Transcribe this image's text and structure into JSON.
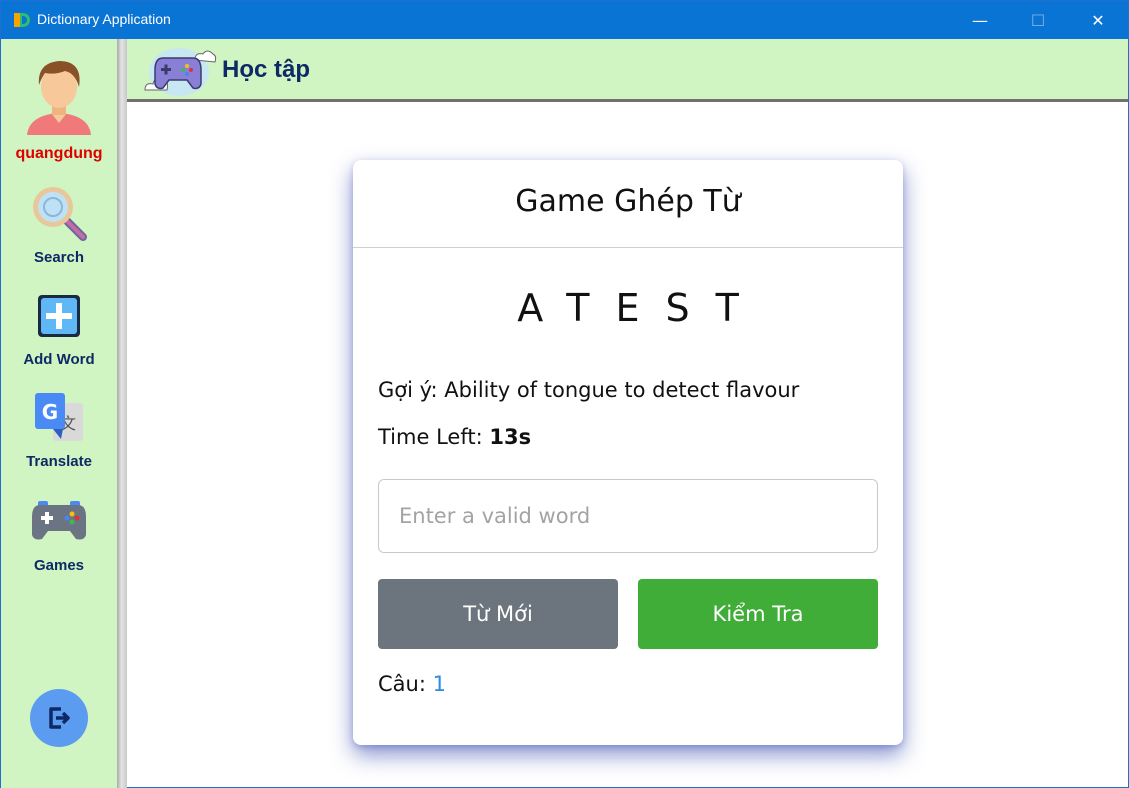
{
  "window": {
    "title": "Dictionary Application",
    "minimize_glyph": "—",
    "maximize_glyph": "☐",
    "close_glyph": "✕"
  },
  "sidebar": {
    "username": "quangdung",
    "items": [
      {
        "label": "Search",
        "icon": "magnifier-icon"
      },
      {
        "label": "Add Word",
        "icon": "plus-icon"
      },
      {
        "label": "Translate",
        "icon": "google-translate-icon"
      },
      {
        "label": "Games",
        "icon": "gamepad-icon"
      }
    ],
    "logout_icon": "logout-icon"
  },
  "header": {
    "title": "Học tập"
  },
  "game": {
    "title": "Game Ghép Từ",
    "scrambled": "ATEST",
    "hint_label": "Gợi ý:",
    "hint_text": "Ability of tongue to detect flavour",
    "time_label": "Time Left:",
    "time_value": "13s",
    "input_value": "",
    "input_placeholder": "Enter a valid word",
    "new_word_label": "Từ Mới",
    "check_label": "Kiểm Tra",
    "counter_label": "Câu:",
    "counter_value": "1"
  },
  "colors": {
    "titlebar": "#0a74d4",
    "sidebar_bg": "#d0f5c2",
    "nav_text": "#0e2a66",
    "username": "#e00000",
    "btn_gray": "#6c757d",
    "btn_green": "#41ad39",
    "counter_accent": "#2d8be0"
  }
}
